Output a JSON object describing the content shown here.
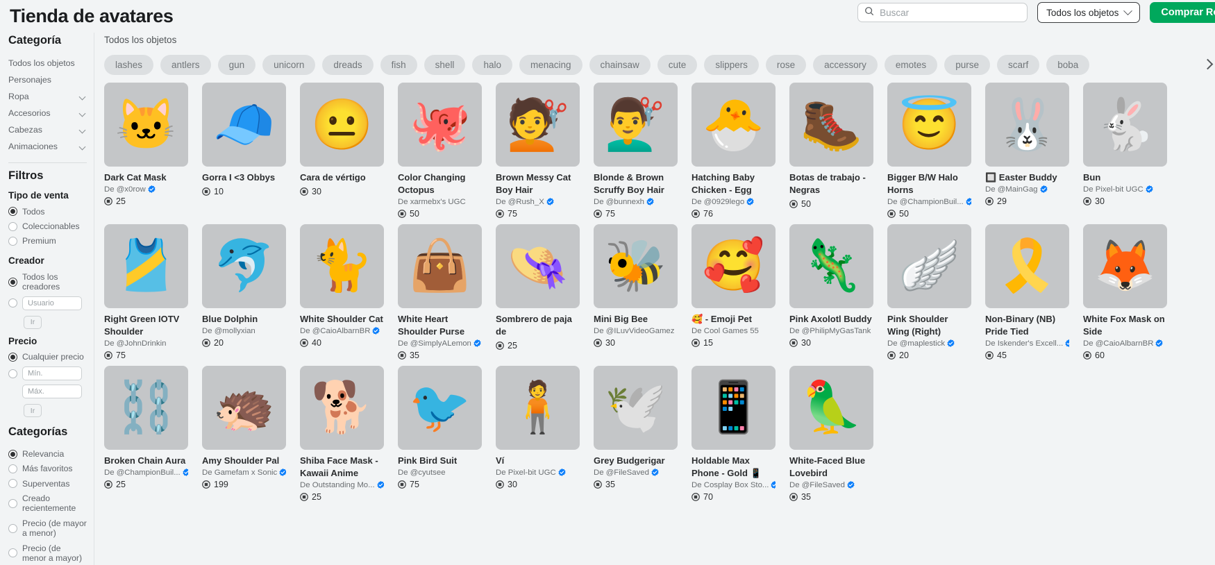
{
  "header": {
    "title": "Tienda de avatares",
    "search": {
      "placeholder": "Buscar",
      "value": "",
      "icon": "search-icon"
    },
    "filter_dropdown": {
      "label": "Todos los objetos",
      "icon": "chevron-down-icon"
    },
    "buy_robux_label": "Comprar Robux",
    "accent_green": "#00a85c"
  },
  "sidebar": {
    "category_heading": "Categoría",
    "category_items": [
      {
        "label": "Todos los objetos",
        "expandable": false
      },
      {
        "label": "Personajes",
        "expandable": false
      },
      {
        "label": "Ropa",
        "expandable": true
      },
      {
        "label": "Accesorios",
        "expandable": true
      },
      {
        "label": "Cabezas",
        "expandable": true
      },
      {
        "label": "Animaciones",
        "expandable": true
      }
    ],
    "filters_heading": "Filtros",
    "sale_type": {
      "heading": "Tipo de venta",
      "options": [
        {
          "label": "Todos",
          "selected": true
        },
        {
          "label": "Coleccionables",
          "selected": false
        },
        {
          "label": "Premium",
          "selected": false
        }
      ]
    },
    "creator": {
      "heading": "Creador",
      "options": [
        {
          "label": "Todos los creadores",
          "selected": true
        }
      ],
      "user_placeholder": "Usuario",
      "user_value": "",
      "go_label": "Ir"
    },
    "price": {
      "heading": "Precio",
      "options": [
        {
          "label": "Cualquier precio",
          "selected": true
        }
      ],
      "min_placeholder": "Mín.",
      "min_value": "",
      "max_placeholder": "Máx.",
      "max_value": "",
      "go_label": "Ir"
    },
    "categories": {
      "heading": "Categorías",
      "options": [
        {
          "label": "Relevancia",
          "selected": true
        },
        {
          "label": "Más favoritos",
          "selected": false
        },
        {
          "label": "Superventas",
          "selected": false
        },
        {
          "label": "Creado recientemente",
          "selected": false
        },
        {
          "label": "Precio (de mayor a menor)",
          "selected": false
        },
        {
          "label": "Precio (de menor a mayor)",
          "selected": false
        }
      ]
    }
  },
  "main": {
    "breadcrumb": "Todos los objetos",
    "tags": [
      "lashes",
      "antlers",
      "gun",
      "unicorn",
      "dreads",
      "fish",
      "shell",
      "halo",
      "menacing",
      "chainsaw",
      "cute",
      "slippers",
      "rose",
      "accessory",
      "emotes",
      "purse",
      "scarf",
      "boba"
    ],
    "next_arrow_icon": "chevron-right-icon",
    "items": [
      {
        "name": "Dark Cat Mask",
        "creator": "De @x0row",
        "verified": true,
        "price": "25",
        "art": "🐱",
        "bg": "#c4c6c8"
      },
      {
        "name": "Gorra I <3 Obbys",
        "creator": "",
        "verified": false,
        "price": "10",
        "art": "🧢",
        "bg": "#c4c6c8"
      },
      {
        "name": "Cara de vértigo",
        "creator": "",
        "verified": false,
        "price": "30",
        "art": "😐",
        "bg": "#c4c6c8"
      },
      {
        "name": "Color Changing Octopus",
        "creator": "De xarmebx's UGC",
        "verified": false,
        "price": "50",
        "art": "🐙",
        "bg": "#c4c6c8"
      },
      {
        "name": "Brown Messy Cat Boy Hair",
        "creator": "De @Rush_X",
        "verified": true,
        "price": "75",
        "art": "💇",
        "bg": "#c4c6c8"
      },
      {
        "name": "Blonde & Brown Scruffy Boy Hair",
        "creator": "De @bunnexh",
        "verified": true,
        "price": "75",
        "art": "💇‍♂️",
        "bg": "#c4c6c8"
      },
      {
        "name": "Hatching Baby Chicken - Egg",
        "creator": "De @0929lego",
        "verified": true,
        "price": "76",
        "art": "🐣",
        "bg": "#c4c6c8"
      },
      {
        "name": "Botas de trabajo - Negras",
        "creator": "",
        "verified": false,
        "price": "50",
        "art": "🥾",
        "bg": "#c4c6c8"
      },
      {
        "name": "Bigger B/W Halo Horns",
        "creator": "De @ChampionBuil...",
        "verified": true,
        "price": "50",
        "art": "😇",
        "bg": "#c4c6c8"
      },
      {
        "name": "🔲 Easter Buddy",
        "creator": "De @MainGag",
        "verified": true,
        "price": "29",
        "art": "🐰",
        "bg": "#c4c6c8"
      },
      {
        "name": "Bun",
        "creator": "De Pixel-bit UGC",
        "verified": true,
        "price": "30",
        "art": "🐇",
        "bg": "#c4c6c8"
      },
      {
        "name": "Right Green IOTV Shoulder",
        "creator": "De @JohnDrinkin",
        "verified": false,
        "price": "75",
        "art": "🎽",
        "bg": "#c4c6c8"
      },
      {
        "name": "Blue Dolphin",
        "creator": "De @mollyxian",
        "verified": false,
        "price": "20",
        "art": "🐬",
        "bg": "#c4c6c8"
      },
      {
        "name": "White Shoulder Cat",
        "creator": "De @CaioAlbarnBR",
        "verified": true,
        "price": "40",
        "art": "🐈",
        "bg": "#c4c6c8"
      },
      {
        "name": "White Heart Shoulder Purse",
        "creator": "De @SimplyALemon",
        "verified": true,
        "price": "35",
        "art": "👜",
        "bg": "#c4c6c8"
      },
      {
        "name": "Sombrero de paja de",
        "creator": "",
        "verified": false,
        "price": "25",
        "art": "👒",
        "bg": "#c4c6c8"
      },
      {
        "name": "Mini Big Bee",
        "creator": "De @ILuvVideoGamez",
        "verified": false,
        "price": "30",
        "art": "🐝",
        "bg": "#c4c6c8"
      },
      {
        "name": "🥰 - Emoji Pet",
        "creator": "De Cool Games 55",
        "verified": false,
        "price": "15",
        "art": "🥰",
        "bg": "#c4c6c8"
      },
      {
        "name": "Pink Axolotl Buddy",
        "creator": "De @PhilipMyGasTank",
        "verified": false,
        "price": "30",
        "art": "🦎",
        "bg": "#c4c6c8"
      },
      {
        "name": "Pink Shoulder Wing (Right)",
        "creator": "De @maplestick",
        "verified": true,
        "price": "20",
        "art": "🪽",
        "bg": "#c4c6c8"
      },
      {
        "name": "Non-Binary (NB) Pride Tied",
        "creator": "De Iskender's Excell...",
        "verified": true,
        "price": "45",
        "art": "🎗️",
        "bg": "#c4c6c8"
      },
      {
        "name": "White Fox Mask on Side",
        "creator": "De @CaioAlbarnBR",
        "verified": true,
        "price": "60",
        "art": "🦊",
        "bg": "#c4c6c8"
      },
      {
        "name": "Broken Chain Aura",
        "creator": "De @ChampionBuil...",
        "verified": true,
        "price": "25",
        "art": "⛓️",
        "bg": "#c4c6c8"
      },
      {
        "name": "Amy Shoulder Pal",
        "creator": "De Gamefam x Sonic",
        "verified": true,
        "price": "199",
        "art": "🦔",
        "bg": "#c4c6c8"
      },
      {
        "name": "Shiba Face Mask - Kawaii Anime",
        "creator": "De Outstanding Mo...",
        "verified": true,
        "price": "25",
        "art": "🐕",
        "bg": "#c4c6c8"
      },
      {
        "name": "Pink Bird Suit",
        "creator": "De @cyutsee",
        "verified": false,
        "price": "75",
        "art": "🐦",
        "bg": "#c4c6c8"
      },
      {
        "name": "Ví",
        "creator": "De Pixel-bit UGC",
        "verified": true,
        "price": "30",
        "art": "🧍",
        "bg": "#c4c6c8"
      },
      {
        "name": "Grey Budgerigar",
        "creator": "De @FileSaved",
        "verified": true,
        "price": "35",
        "art": "🕊️",
        "bg": "#c4c6c8"
      },
      {
        "name": "Holdable Max Phone - Gold 📱",
        "creator": "De Cosplay Box Sto...",
        "verified": true,
        "price": "70",
        "art": "📱",
        "bg": "#c4c6c8"
      },
      {
        "name": "White-Faced Blue Lovebird",
        "creator": "De @FileSaved",
        "verified": true,
        "price": "35",
        "art": "🦜",
        "bg": "#c4c6c8"
      }
    ]
  }
}
